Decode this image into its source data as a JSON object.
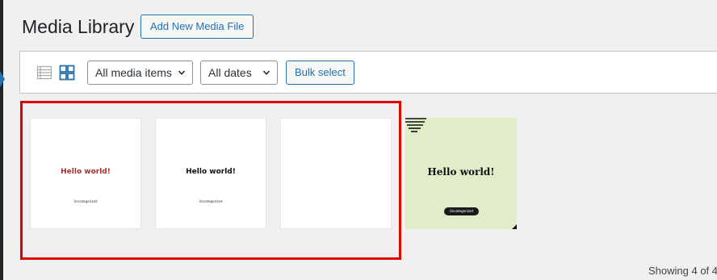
{
  "header": {
    "title": "Media Library",
    "add_new_label": "Add New Media File"
  },
  "toolbar": {
    "view_modes": [
      {
        "name": "list",
        "icon": "list-view-icon",
        "active": false
      },
      {
        "name": "grid",
        "icon": "grid-view-icon",
        "active": true
      }
    ],
    "media_filter": {
      "selected": "All media items"
    },
    "date_filter": {
      "selected": "All dates"
    },
    "bulk_select_label": "Bulk select"
  },
  "attachments": [
    {
      "title": "Hello world!",
      "category": "Uncategorized",
      "style": "white-red-title"
    },
    {
      "title": "Hello world!",
      "category": "Uncategorized",
      "style": "white-black-title"
    },
    {
      "title": "",
      "category": "",
      "style": "blank"
    },
    {
      "title": "Hello world!",
      "category": "Uncategorized",
      "style": "green-pill"
    }
  ],
  "footer": {
    "showing_text": "Showing 4 of 4"
  },
  "colors": {
    "accent": "#2271b1",
    "background": "#f0f0f1",
    "highlight": "#e00000",
    "thumb_green": "#e1ecc8",
    "thumb_red_title": "#a83232"
  }
}
